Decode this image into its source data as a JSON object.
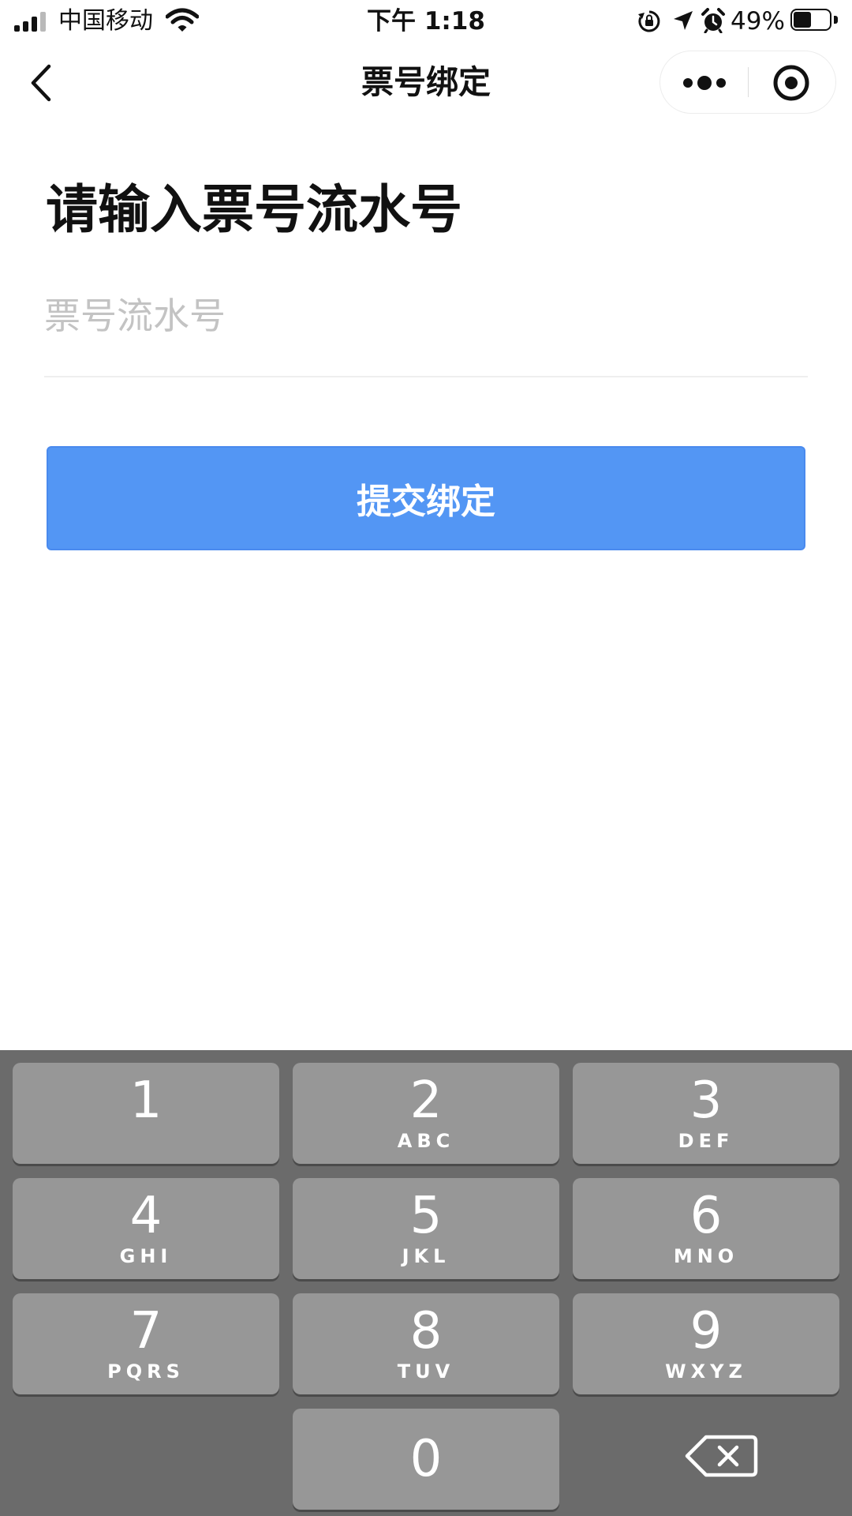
{
  "status_bar": {
    "carrier": "中国移动",
    "time": "下午 1:18",
    "battery_percent_text": "49%",
    "battery_level": 0.49,
    "icons": [
      "signal-icon",
      "wifi-icon",
      "orientation-lock-icon",
      "location-icon",
      "alarm-icon",
      "battery-icon"
    ]
  },
  "nav": {
    "title": "票号绑定",
    "icons": [
      "back-chevron-icon",
      "more-dots-icon",
      "close-target-icon"
    ]
  },
  "main": {
    "heading": "请输入票号流水号",
    "input": {
      "placeholder": "票号流水号",
      "value": ""
    },
    "submit_label": "提交绑定"
  },
  "colors": {
    "button_blue": "#5396f4",
    "keypad_bg": "#6b6b6b",
    "key_bg": "#979797",
    "placeholder": "#c3c3c3"
  },
  "keypad": {
    "keys": [
      {
        "digit": "1",
        "letters": ""
      },
      {
        "digit": "2",
        "letters": "ABC"
      },
      {
        "digit": "3",
        "letters": "DEF"
      },
      {
        "digit": "4",
        "letters": "GHI"
      },
      {
        "digit": "5",
        "letters": "JKL"
      },
      {
        "digit": "6",
        "letters": "MNO"
      },
      {
        "digit": "7",
        "letters": "PQRS"
      },
      {
        "digit": "8",
        "letters": "TUV"
      },
      {
        "digit": "9",
        "letters": "WXYZ"
      },
      {
        "digit": "0",
        "letters": ""
      }
    ],
    "delete_icon": "backspace-icon"
  }
}
